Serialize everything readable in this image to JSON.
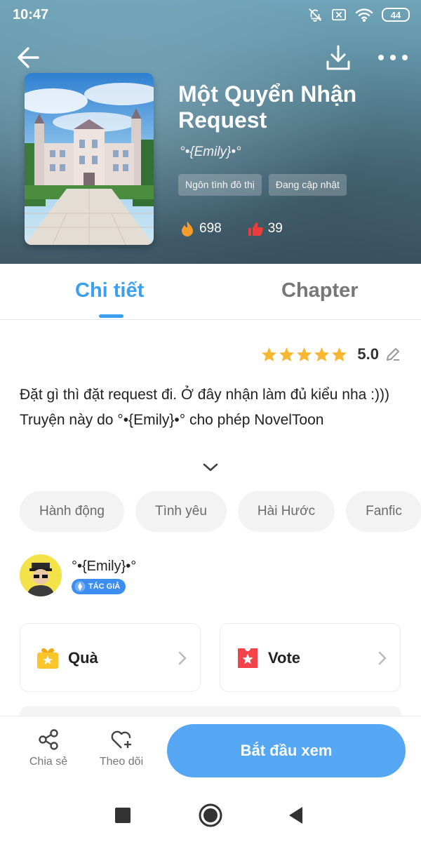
{
  "status_bar": {
    "time": "10:47",
    "battery": "44",
    "icons": [
      "bell-off-icon",
      "sim-off-icon",
      "wifi-icon",
      "battery-icon"
    ]
  },
  "header": {
    "back_icon": "arrow-left-icon",
    "download_icon": "download-icon",
    "more_icon": "more-dots-icon"
  },
  "book": {
    "title": "Một Quyển Nhận Request",
    "author": "°•{Emily}•°",
    "genres": [
      "Ngôn tình đô thị",
      "Đang cập nhật"
    ],
    "views": "698",
    "likes": "39",
    "cover_icon": "castle-cover-image"
  },
  "tabs": [
    {
      "label": "Chi tiết",
      "active": true
    },
    {
      "label": "Chapter",
      "active": false
    }
  ],
  "rating": {
    "value": "5.0",
    "stars": 5,
    "star_color": "#f7b731",
    "edit_icon": "pencil-icon"
  },
  "description": {
    "line1": "Đặt gì thì đặt request đi. Ở đây nhận làm đủ kiểu nha :)))",
    "line2": "Truyện này do °•{Emily}•° cho phép NovelToon"
  },
  "categories": [
    "Hành động",
    "Tình yêu",
    "Hài Hước",
    "Fanfic"
  ],
  "author_info": {
    "name": "°•{Emily}•°",
    "badge": "TÁC GIẢ"
  },
  "actions": {
    "gift_label": "Quà",
    "vote_label": "Vote"
  },
  "bottom_bar": {
    "share_label": "Chia sẻ",
    "follow_label": "Theo dõi",
    "start_label": "Bắt đầu xem"
  },
  "colors": {
    "accent": "#3aa0ef",
    "start_button": "#55a7f3",
    "vote_red": "#f2434b",
    "gift_yellow": "#f9c52b"
  }
}
